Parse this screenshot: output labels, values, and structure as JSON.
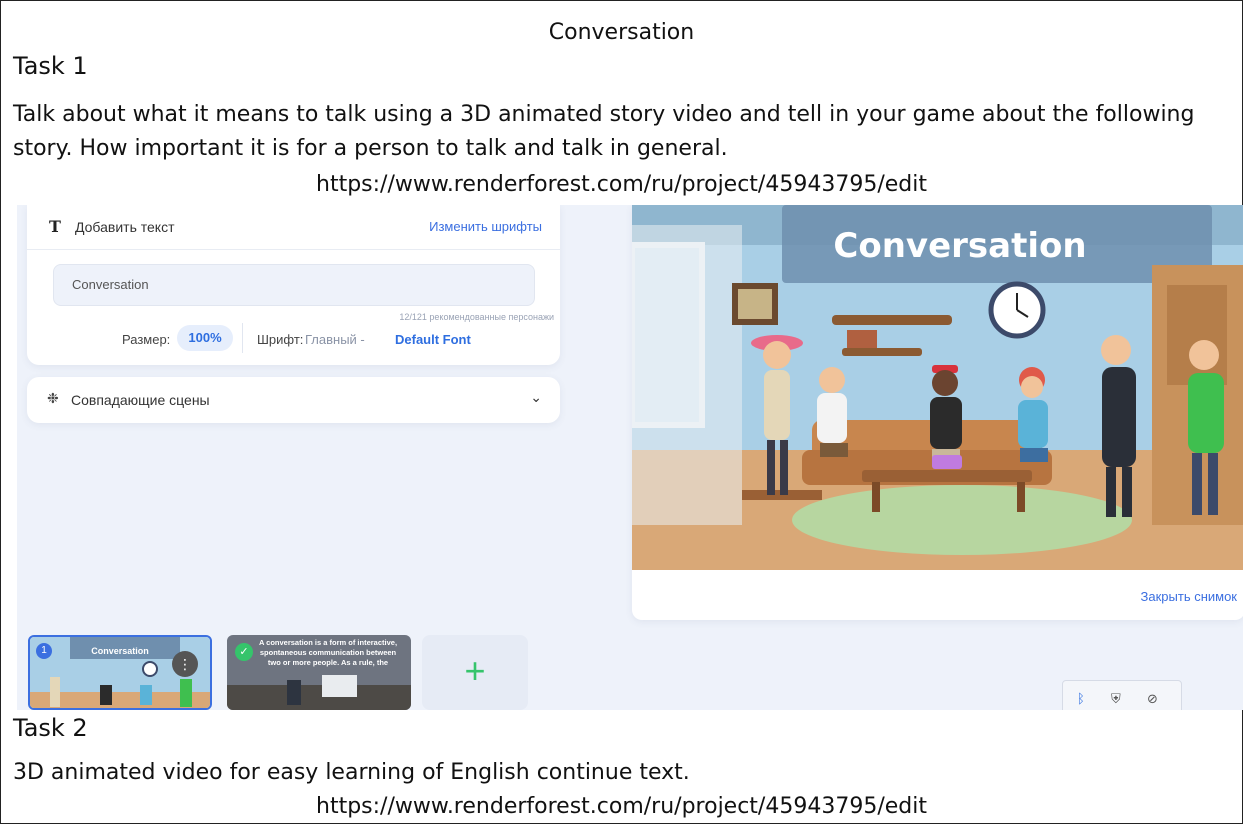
{
  "document": {
    "title": "Conversation",
    "task1": {
      "heading": "Task 1",
      "body": "Talk about what it means to talk using a 3D animated story video and tell in your game about the following story. How important it is for a person to talk and talk in general.",
      "link": "https://www.renderforest.com/ru/project/45943795/edit"
    },
    "task2": {
      "heading": "Task 2",
      "body": "3D animated video for easy learning of English continue text.",
      "link": "https://www.renderforest.com/ru/project/45943795/edit"
    }
  },
  "editor": {
    "text_panel": {
      "icon": "text-t-icon",
      "add_text_label": "Добавить текст",
      "change_fonts": "Изменить шрифты",
      "input_value": "Conversation",
      "char_count": "12/121 рекомендованные персонажи",
      "size_label": "Размер:",
      "size_value": "100%",
      "font_label": "Шрифт:",
      "font_main": "Главный -",
      "font_default": "Default Font"
    },
    "scenes_panel": {
      "icon": "scenes-icon",
      "label": "Совпадающие сцены",
      "chevron": "chevron-down-icon"
    },
    "preview": {
      "title": "Conversation",
      "close_label": "Закрыть снимок"
    },
    "filmstrip": {
      "thumb1_title": "Conversation",
      "thumb1_badge": "1",
      "thumb2_text": "A conversation is a form of interactive, spontaneous communication between two or more people. As a rule, the",
      "add_label": "+"
    },
    "tray_icons": [
      "bluetooth-icon",
      "shield-icon",
      "eye-off-icon"
    ],
    "colors": {
      "accent": "#3b6fe0",
      "success": "#35c46b",
      "page_bg": "#eef2fa"
    }
  }
}
